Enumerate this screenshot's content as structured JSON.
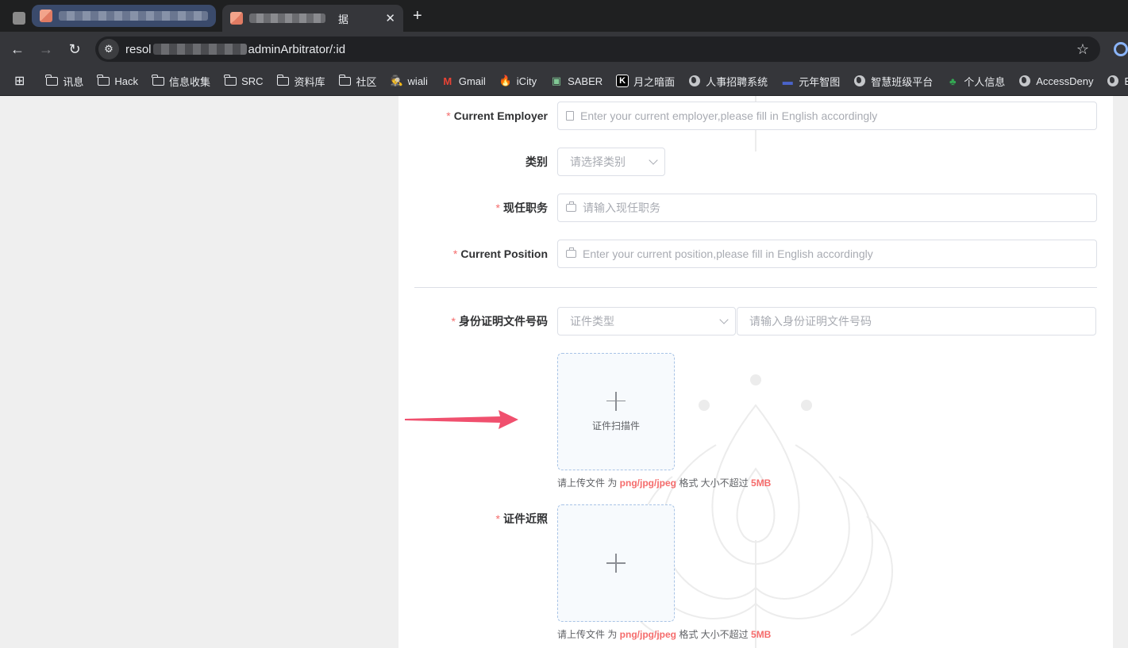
{
  "browser": {
    "tabs": [
      {
        "title": ""
      },
      {
        "title": ""
      },
      {
        "title_tail": "据"
      }
    ],
    "new_tab": "+",
    "url": {
      "prefix": "resol",
      "suffix": "adminArbitrator/:id"
    },
    "bookmarks": [
      {
        "label": "讯息",
        "icon": "folder-icon"
      },
      {
        "label": "Hack",
        "icon": "folder-icon"
      },
      {
        "label": "信息收集",
        "icon": "folder-icon"
      },
      {
        "label": "SRC",
        "icon": "folder-icon"
      },
      {
        "label": "资料库",
        "icon": "folder-icon"
      },
      {
        "label": "社区",
        "icon": "folder-icon"
      },
      {
        "label": "wiali",
        "icon": "hacker-icon"
      },
      {
        "label": "Gmail",
        "icon": "gmail-icon"
      },
      {
        "label": "iCity",
        "icon": "flame-icon"
      },
      {
        "label": "SABER",
        "icon": "saber-icon"
      },
      {
        "label": "月之暗面",
        "icon": "kimi-icon"
      },
      {
        "label": "人事招聘系统",
        "icon": "globe-icon"
      },
      {
        "label": "元年智图",
        "icon": "chart-icon"
      },
      {
        "label": "智慧班级平台",
        "icon": "globe-icon"
      },
      {
        "label": "个人信息",
        "icon": "tree-icon"
      },
      {
        "label": "AccessDeny",
        "icon": "globe-icon"
      },
      {
        "label": "Burp",
        "icon": "globe-icon"
      }
    ]
  },
  "form": {
    "required_mark": "*",
    "current_employer": {
      "label": "Current Employer",
      "placeholder": "Enter your current employer,please fill in English accordingly"
    },
    "category": {
      "label": "类别",
      "placeholder": "请选择类别"
    },
    "position_cn": {
      "label": "现任职务",
      "placeholder": "请输入现任职务"
    },
    "position_en": {
      "label": "Current Position",
      "placeholder": "Enter your current position,please fill in English accordingly"
    },
    "id_doc": {
      "label": "身份证明文件号码",
      "type_placeholder": "证件类型",
      "number_placeholder": "请输入身份证明文件号码"
    },
    "scan_upload": {
      "text": "证件扫描件"
    },
    "upload_hint": {
      "p1": "请上传文件 为 ",
      "formats": "png/jpg/jpeg",
      "p2": " 格式 大小不超过 ",
      "size": "5MB"
    },
    "photo": {
      "label": "证件近照"
    }
  },
  "colors": {
    "required": "#f56c6c",
    "arrow": "#f0506e",
    "border": "#dcdfe6",
    "placeholder": "#a8abb2"
  }
}
